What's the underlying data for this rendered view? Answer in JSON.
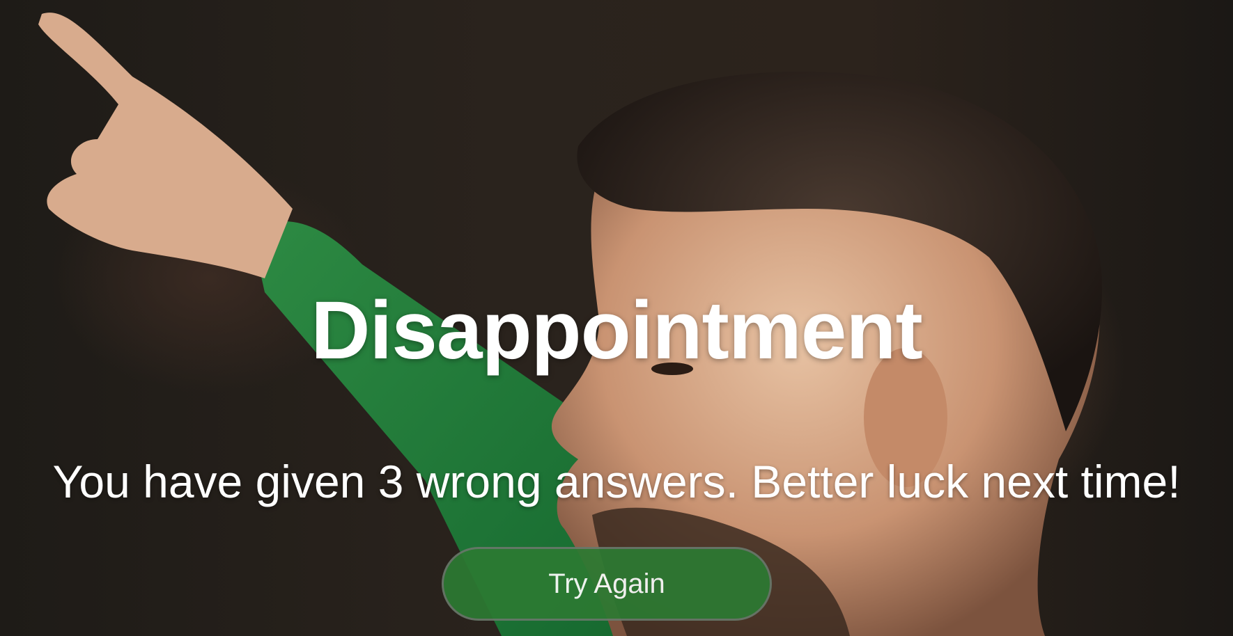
{
  "screen": {
    "title": "Disappointment",
    "message": "You have given 3 wrong answers. Better luck next time!",
    "button_label": "Try Again"
  },
  "colors": {
    "button_background": "#2c7a32",
    "text": "#ffffff"
  },
  "background_image": "close-up photo of a bearded footballer in a green jersey pointing upward"
}
